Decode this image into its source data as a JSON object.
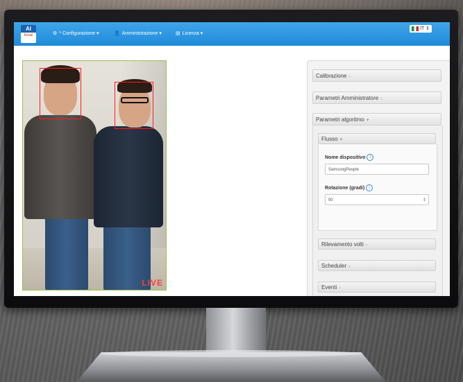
{
  "navbar": {
    "logo_text": "AI",
    "logo_sub": "Retail",
    "menu": [
      {
        "icon": "gear-icon",
        "label": "Configurazione",
        "prefix": "*"
      },
      {
        "icon": "user-icon",
        "label": "Amministrazione"
      },
      {
        "icon": "license-icon",
        "label": "Licenza"
      }
    ],
    "language": "IT"
  },
  "camera": {
    "overlay": "LIVE"
  },
  "panel": {
    "sections": {
      "calibrazione": "Calibrazione",
      "parametri_amministratore": "Parametri Amministratore",
      "parametri_algoritmo": "Parametri algoritmo"
    },
    "subsections": {
      "flusso": "Flusso",
      "rilevamento_volti": "Rilevamento volti",
      "scheduler": "Scheduler",
      "eventi": "Eventi"
    },
    "fields": {
      "nome_dispositivo_label": "Nome dispositivo",
      "nome_dispositivo_value": "SamsungPeople",
      "rotazione_label": "Rotazione (gradi)",
      "rotazione_value": "90"
    }
  }
}
